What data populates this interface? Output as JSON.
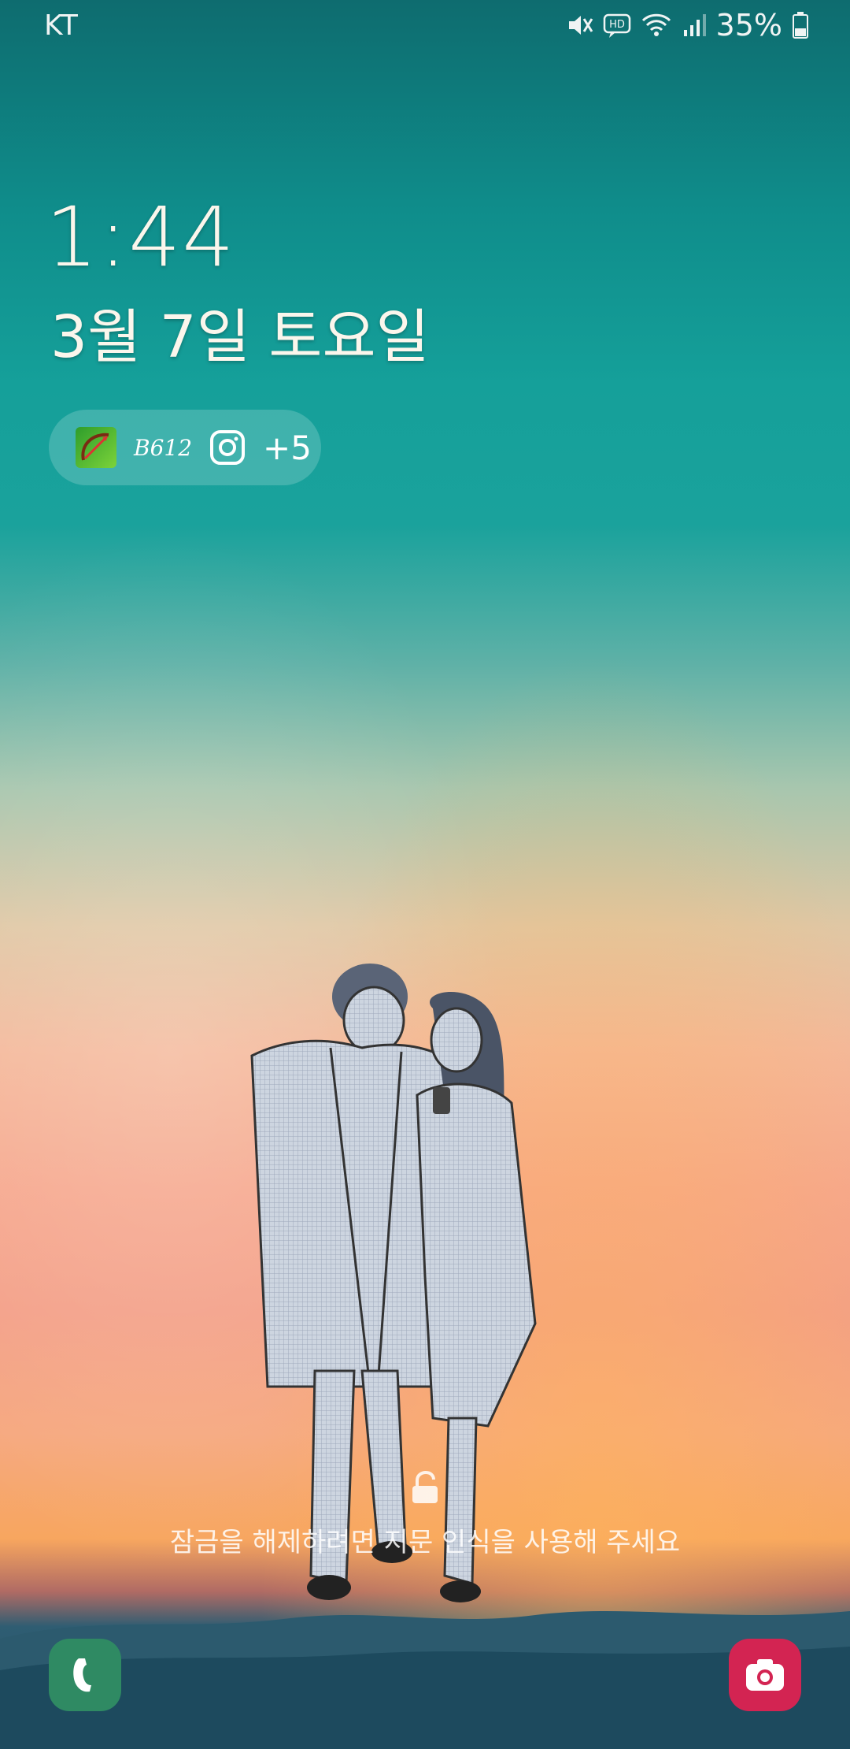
{
  "status_bar": {
    "carrier": "KT",
    "battery_percent": "35%",
    "icons": [
      "mute-icon",
      "hd-voice-icon",
      "wifi-icon",
      "signal-icon",
      "battery-icon"
    ]
  },
  "lock_screen": {
    "time": "1:44",
    "date": "3월 7일 토요일",
    "notifications": {
      "apps": [
        "archery-app-icon",
        "b612-app-icon",
        "instagram-icon"
      ],
      "b612_label": "B612",
      "more_count": "+5"
    },
    "unlock_hint": "잠금을 해제하려면 지문 인식을 사용해 주세요"
  },
  "shortcuts": {
    "left": "phone-icon",
    "right": "camera-icon"
  },
  "colors": {
    "phone_shortcut": "#2f8a63",
    "camera_shortcut": "#d32452",
    "sky_top": "#0e6c6f",
    "sky_bottom": "#f6a78d"
  }
}
